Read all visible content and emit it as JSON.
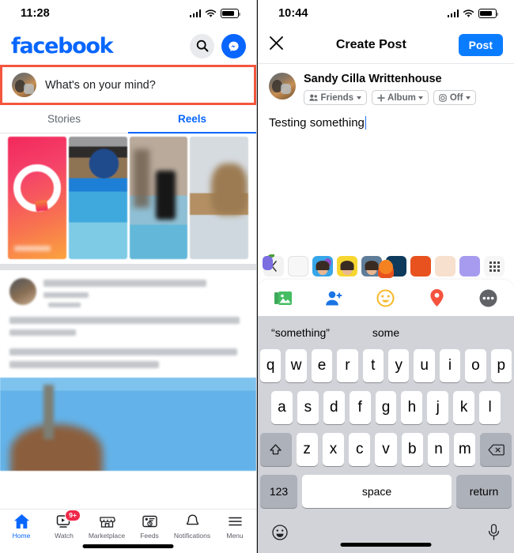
{
  "left_phone": {
    "status_bar": {
      "time": "11:28",
      "cellular_icon": "signal-bars-icon",
      "wifi_icon": "wifi-icon",
      "battery_icon": "battery-icon"
    },
    "header": {
      "logo_text": "facebook",
      "logo_color": "#0866ff",
      "search_icon": "search-icon",
      "messenger_icon": "messenger-icon"
    },
    "composer": {
      "placeholder": "What's on your mind?",
      "avatar": "user-avatar",
      "highlight_color": "#f4553d"
    },
    "tabs": [
      {
        "label": "Stories",
        "active": false
      },
      {
        "label": "Reels",
        "active": true
      }
    ],
    "reels": [
      {
        "name": "create-reel-card"
      },
      {
        "name": "reel-thumbnail-2"
      },
      {
        "name": "reel-thumbnail-3"
      },
      {
        "name": "reel-thumbnail-4"
      }
    ],
    "feed_post": {
      "author": "blurred",
      "body": "blurred",
      "photo": "blurred-sky-photo"
    },
    "bottom_nav": [
      {
        "label": "Home",
        "icon": "home-icon",
        "active": true,
        "badge": ""
      },
      {
        "label": "Watch",
        "icon": "watch-icon",
        "active": false,
        "badge": "9+"
      },
      {
        "label": "Marketplace",
        "icon": "marketplace-icon",
        "active": false,
        "badge": ""
      },
      {
        "label": "Feeds",
        "icon": "feeds-icon",
        "active": false,
        "badge": ""
      },
      {
        "label": "Notifications",
        "icon": "bell-icon",
        "active": false,
        "badge": ""
      },
      {
        "label": "Menu",
        "icon": "hamburger-menu-icon",
        "active": false,
        "badge": ""
      }
    ]
  },
  "right_phone": {
    "status_bar": {
      "time": "10:44",
      "cellular_icon": "signal-bars-icon",
      "wifi_icon": "wifi-icon",
      "battery_icon": "battery-icon"
    },
    "header": {
      "close_icon": "close-icon",
      "title": "Create Post",
      "post_label": "Post",
      "post_color": "#0a7cff"
    },
    "user": {
      "name": "Sandy Cilla Writtenhouse",
      "avatar": "user-avatar",
      "chips": [
        {
          "label": "Friends",
          "icon": "friends-icon"
        },
        {
          "label": "Album",
          "icon": "plus-icon"
        },
        {
          "label": "Off",
          "icon": "instagram-icon"
        }
      ]
    },
    "composer": {
      "text": "Testing something",
      "cursor": true
    },
    "sticker_row": {
      "back_icon": "chevron-left-icon",
      "grid_icon": "sticker-grid-icon",
      "stickers": [
        "blank-sticker",
        "memoji-balloon",
        "memoji-yellow",
        "memoji-graduation",
        "olive-sticker",
        "cat-sticker",
        "orange-sticker",
        "thumb-sticker"
      ]
    },
    "action_bar": [
      {
        "name": "photo-video-icon"
      },
      {
        "name": "tag-people-icon"
      },
      {
        "name": "feeling-activity-icon"
      },
      {
        "name": "check-in-location-icon"
      },
      {
        "name": "more-options-icon"
      }
    ],
    "keyboard": {
      "suggestions": [
        "“something”",
        "some",
        ""
      ],
      "row1": [
        "q",
        "w",
        "e",
        "r",
        "t",
        "y",
        "u",
        "i",
        "o",
        "p"
      ],
      "row2": [
        "a",
        "s",
        "d",
        "f",
        "g",
        "h",
        "j",
        "k",
        "l"
      ],
      "row3": [
        "z",
        "x",
        "c",
        "v",
        "b",
        "n",
        "m"
      ],
      "shift_icon": "shift-icon",
      "backspace_icon": "backspace-icon",
      "numbers_label": "123",
      "space_label": "space",
      "return_label": "return",
      "emoji_icon": "emoji-icon",
      "dictation_icon": "microphone-icon"
    }
  }
}
